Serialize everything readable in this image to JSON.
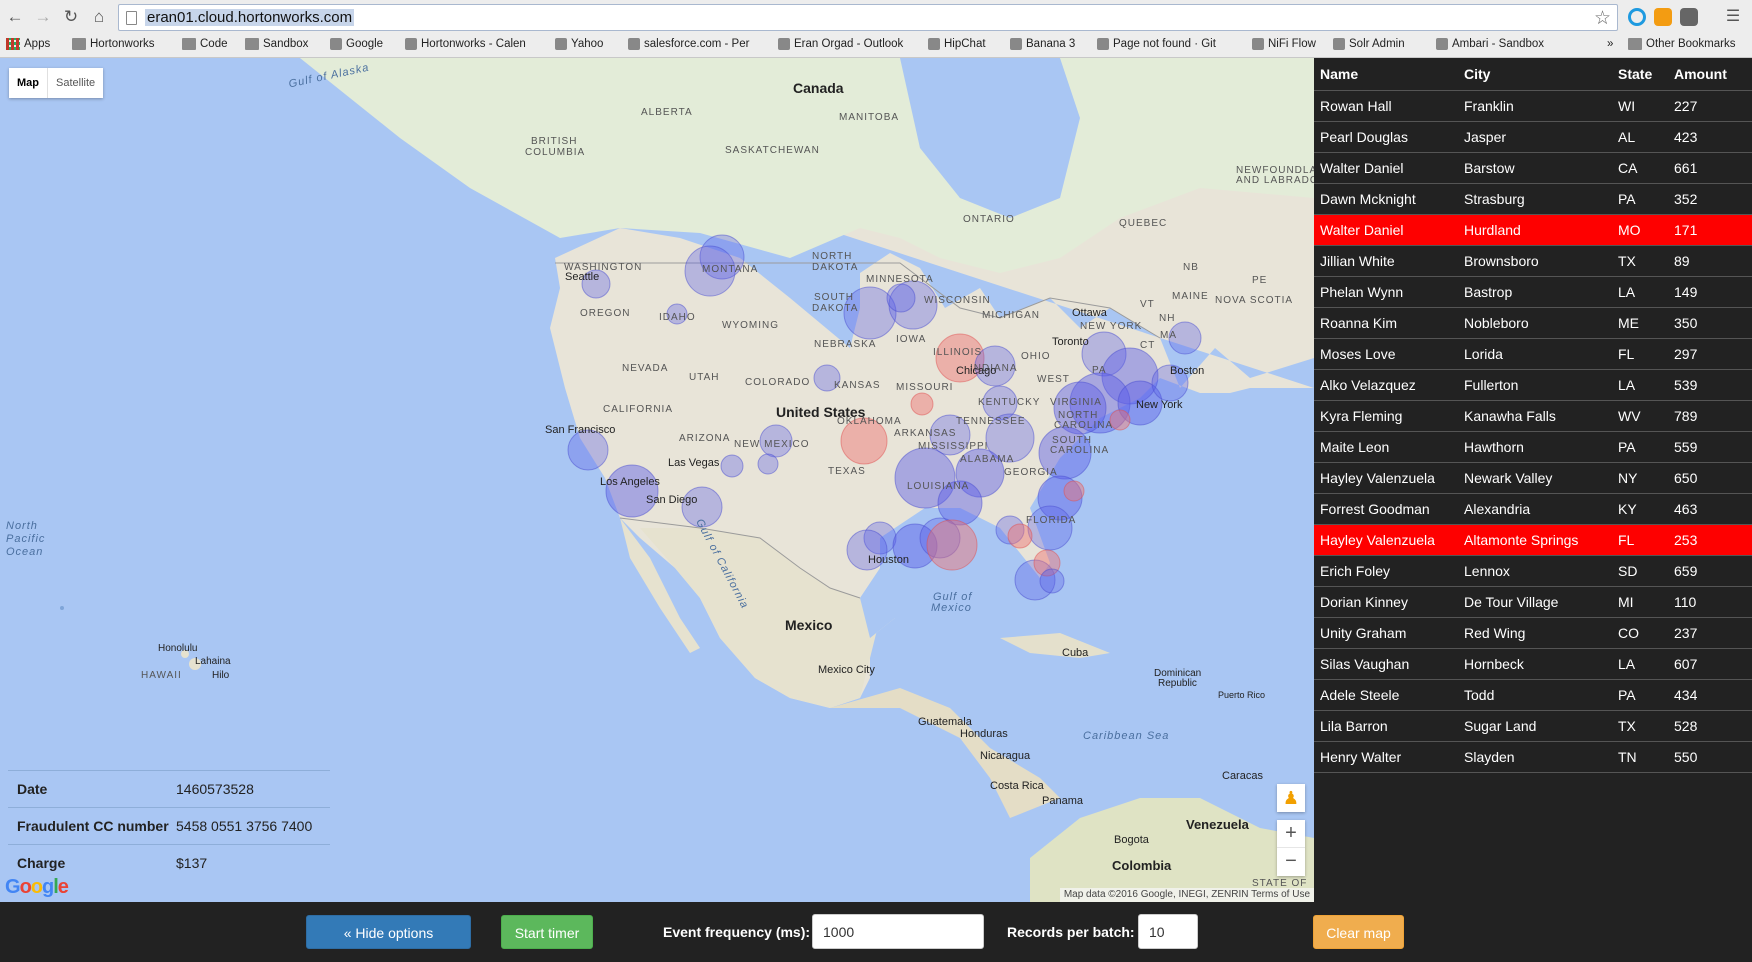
{
  "browser": {
    "url": "eran01.cloud.hortonworks.com",
    "bookmarks": [
      {
        "label": "Apps",
        "icon": "apps-icon"
      },
      {
        "label": "Hortonworks",
        "icon": "folder-icon"
      },
      {
        "label": "Code",
        "icon": "folder-icon"
      },
      {
        "label": "Sandbox",
        "icon": "folder-icon"
      },
      {
        "label": "Google",
        "icon": "google-icon"
      },
      {
        "label": "Hortonworks - Calen",
        "icon": "calendar-icon"
      },
      {
        "label": "Yahoo",
        "icon": "yahoo-icon"
      },
      {
        "label": "salesforce.com - Per",
        "icon": "salesforce-icon"
      },
      {
        "label": "Eran Orgad - Outlook",
        "icon": "outlook-icon"
      },
      {
        "label": "HipChat",
        "icon": "hipchat-icon"
      },
      {
        "label": "Banana 3",
        "icon": "banana-icon"
      },
      {
        "label": "Page not found · Git",
        "icon": "github-icon"
      },
      {
        "label": "NiFi Flow",
        "icon": "nifi-icon"
      },
      {
        "label": "Solr Admin",
        "icon": "solr-icon"
      },
      {
        "label": "Ambari - Sandbox",
        "icon": "ambari-icon"
      }
    ],
    "overflow": "»",
    "other_bookmarks": "Other Bookmarks"
  },
  "map": {
    "type_map": "Map",
    "type_satellite": "Satellite",
    "labels": {
      "canada": "Canada",
      "usa": "United States",
      "mexico": "Mexico",
      "gulf_alaska": "Gulf of Alaska",
      "north_pacific": "North",
      "north_pacific2": "Pacific",
      "north_pacific3": "Ocean",
      "alberta": "ALBERTA",
      "manitoba": "MANITOBA",
      "saskatchewan": "SASKATCHEWAN",
      "bc1": "BRITISH",
      "bc2": "COLUMBIA",
      "ontario": "ONTARIO",
      "quebec": "QUEBEC",
      "newfoundland1": "NEWFOUNDLAN",
      "newfoundland2": "AND LABRADO",
      "nb": "NB",
      "pe": "PE",
      "nova_scotia": "NOVA SCOTIA",
      "washington": "WASHINGTON",
      "montana": "MONTANA",
      "north_dakota1": "NORTH",
      "north_dakota2": "DAKOTA",
      "minnesota": "MINNESOTA",
      "south_dakota1": "SOUTH",
      "south_dakota2": "DAKOTA",
      "wisconsin": "WISCONSIN",
      "michigan": "MICHIGAN",
      "oregon": "OREGON",
      "idaho": "IDAHO",
      "wyoming": "WYOMING",
      "iowa": "IOWA",
      "nebraska": "NEBRASKA",
      "illinois": "ILLINOIS",
      "ohio": "OHIO",
      "indiana": "INDIANA",
      "nevada": "NEVADA",
      "utah": "UTAH",
      "colorado": "COLORADO",
      "kansas": "KANSAS",
      "missouri": "MISSOURI",
      "kentucky": "KENTUCKY",
      "virginia": "VIRGINIA",
      "california": "CALIFORNIA",
      "arizona": "ARIZONA",
      "new_mexico": "NEW MEXICO",
      "oklahoma": "OKLAHOMA",
      "arkansas": "ARKANSAS",
      "tennessee": "TENNESSEE",
      "north_carolina": "NORTH",
      "carolina": "CAROLINA",
      "mississippi": "MISSISSIPPI",
      "alabama": "ALABAMA",
      "georgia": "GEORGIA",
      "south_carolina": "SOUTH",
      "texas": "TEXAS",
      "louisiana": "LOUISIANA",
      "florida": "FLORIDA",
      "new_york_state": "NEW YORK",
      "vt": "VT",
      "nh": "NH",
      "maine": "MAINE",
      "ma": "MA",
      "ct": "CT",
      "pa": "PA",
      "west": "WEST",
      "hawaii": "HAWAII",
      "gulf_california1": "Gulf of California",
      "gulf_mexico1": "Gulf of",
      "gulf_mexico2": "Mexico",
      "caribbean": "Caribbean Sea",
      "venezuela": "Venezuela",
      "colombia": "Colombia",
      "cuba": "Cuba",
      "dominican1": "Dominican",
      "dominican2": "Republic",
      "puerto_rico": "Puerto Rico",
      "guatemala": "Guatemala",
      "honduras": "Honduras",
      "nicaragua": "Nicaragua",
      "costa_rica": "Costa Rica",
      "panama": "Panama",
      "seattle": "Seattle",
      "san_francisco": "San Francisco",
      "las_vegas": "Las Vegas",
      "los_angeles": "Los Angeles",
      "san_diego": "San Diego",
      "chicago": "Chicago",
      "toronto": "Toronto",
      "ottawa": "Ottawa",
      "boston": "Boston",
      "new_york": "New York",
      "houston": "Houston",
      "mexico_city": "Mexico City",
      "honolulu": "Honolulu",
      "lahaina": "Lahaina",
      "hilo": "Hilo",
      "bogota": "Bogota",
      "caracas": "Caracas",
      "state_of": "STATE OF"
    },
    "attribution": "Map data ©2016 Google, INEGI, ZENRIN    Terms of Use",
    "google_logo": [
      "G",
      "o",
      "o",
      "g",
      "l",
      "e"
    ],
    "zoom_in": "+",
    "zoom_out": "−",
    "pegman_icon": "pegman-icon"
  },
  "event_info": {
    "rows": [
      {
        "label": "Date",
        "value": "1460573528"
      },
      {
        "label": "Fraudulent CC number",
        "value": "5458 0551 3756 7400"
      },
      {
        "label": "Charge",
        "value": "$137"
      }
    ]
  },
  "transactions": {
    "headers": {
      "name": "Name",
      "city": "City",
      "state": "State",
      "amount": "Amount"
    },
    "rows": [
      {
        "name": "Rowan Hall",
        "city": "Franklin",
        "state": "WI",
        "amount": "227",
        "fraud": false
      },
      {
        "name": "Pearl Douglas",
        "city": "Jasper",
        "state": "AL",
        "amount": "423",
        "fraud": false
      },
      {
        "name": "Walter Daniel",
        "city": "Barstow",
        "state": "CA",
        "amount": "661",
        "fraud": false
      },
      {
        "name": "Dawn Mcknight",
        "city": "Strasburg",
        "state": "PA",
        "amount": "352",
        "fraud": false
      },
      {
        "name": "Walter Daniel",
        "city": "Hurdland",
        "state": "MO",
        "amount": "171",
        "fraud": true
      },
      {
        "name": "Jillian White",
        "city": "Brownsboro",
        "state": "TX",
        "amount": "89",
        "fraud": false
      },
      {
        "name": "Phelan Wynn",
        "city": "Bastrop",
        "state": "LA",
        "amount": "149",
        "fraud": false
      },
      {
        "name": "Roanna Kim",
        "city": "Nobleboro",
        "state": "ME",
        "amount": "350",
        "fraud": false
      },
      {
        "name": "Moses Love",
        "city": "Lorida",
        "state": "FL",
        "amount": "297",
        "fraud": false
      },
      {
        "name": "Alko Velazquez",
        "city": "Fullerton",
        "state": "LA",
        "amount": "539",
        "fraud": false
      },
      {
        "name": "Kyra Fleming",
        "city": "Kanawha Falls",
        "state": "WV",
        "amount": "789",
        "fraud": false
      },
      {
        "name": "Maite Leon",
        "city": "Hawthorn",
        "state": "PA",
        "amount": "559",
        "fraud": false
      },
      {
        "name": "Hayley Valenzuela",
        "city": "Newark Valley",
        "state": "NY",
        "amount": "650",
        "fraud": false
      },
      {
        "name": "Forrest Goodman",
        "city": "Alexandria",
        "state": "KY",
        "amount": "463",
        "fraud": false
      },
      {
        "name": "Hayley Valenzuela",
        "city": "Altamonte Springs",
        "state": "FL",
        "amount": "253",
        "fraud": true
      },
      {
        "name": "Erich Foley",
        "city": "Lennox",
        "state": "SD",
        "amount": "659",
        "fraud": false
      },
      {
        "name": "Dorian Kinney",
        "city": "De Tour Village",
        "state": "MI",
        "amount": "110",
        "fraud": false
      },
      {
        "name": "Unity Graham",
        "city": "Red Wing",
        "state": "CO",
        "amount": "237",
        "fraud": false
      },
      {
        "name": "Silas Vaughan",
        "city": "Hornbeck",
        "state": "LA",
        "amount": "607",
        "fraud": false
      },
      {
        "name": "Adele Steele",
        "city": "Todd",
        "state": "PA",
        "amount": "434",
        "fraud": false
      },
      {
        "name": "Lila Barron",
        "city": "Sugar Land",
        "state": "TX",
        "amount": "528",
        "fraud": false
      },
      {
        "name": "Henry Walter",
        "city": "Slayden",
        "state": "TN",
        "amount": "550",
        "fraud": false
      }
    ],
    "fraud_color": "#fe0000"
  },
  "controls": {
    "hide_options": "« Hide options",
    "start_timer": "Start timer",
    "event_frequency_label": "Event frequency (ms):",
    "event_frequency_value": "1000",
    "records_per_batch_label": "Records per batch:",
    "records_per_batch_value": "10",
    "clear_map": "Clear map"
  }
}
